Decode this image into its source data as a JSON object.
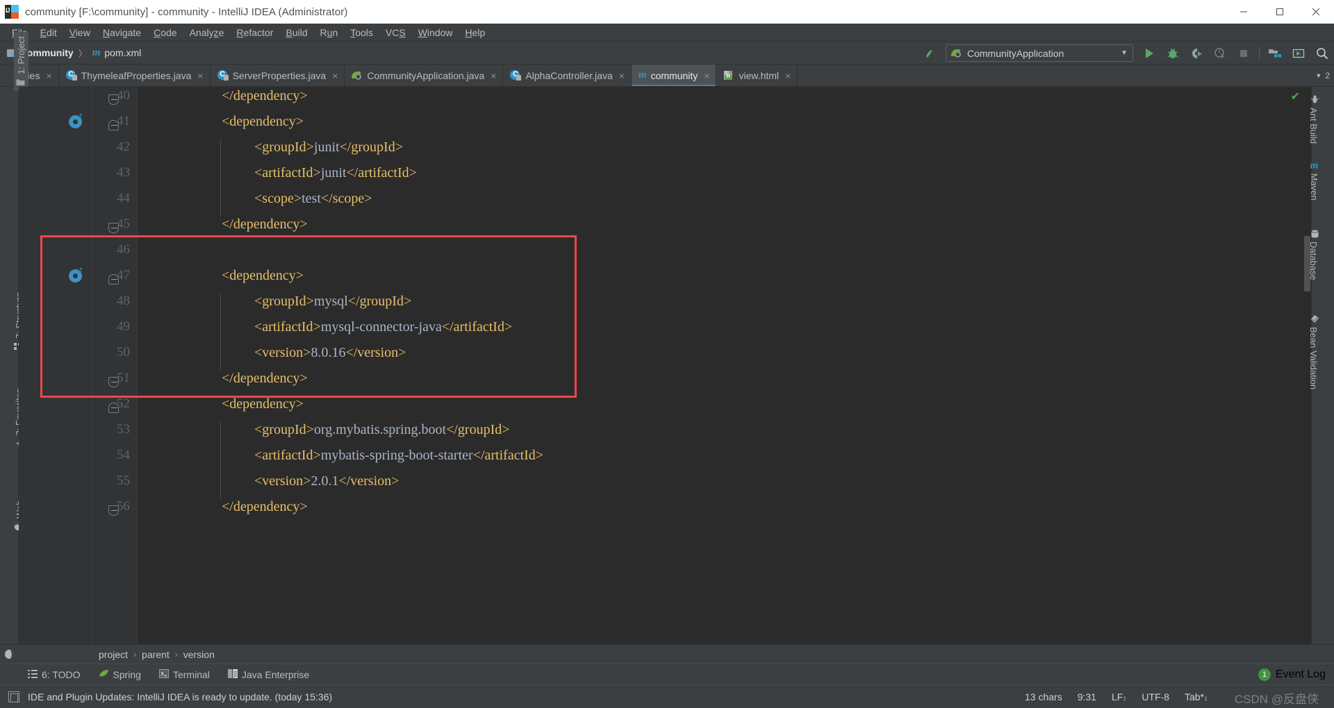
{
  "window": {
    "title": "community [F:\\community] - community - IntelliJ IDEA (Administrator)",
    "minimize_label": "—",
    "maximize_label": "❐",
    "close_label": "✕"
  },
  "menubar": {
    "items": [
      "File",
      "Edit",
      "View",
      "Navigate",
      "Code",
      "Analyze",
      "Refactor",
      "Build",
      "Run",
      "Tools",
      "VCS",
      "Window",
      "Help"
    ]
  },
  "navbar": {
    "crumbs": [
      "community",
      "pom.xml"
    ],
    "separator": "〉",
    "run_config": {
      "name": "CommunityApplication",
      "caret": "▼"
    },
    "buttons": [
      {
        "name": "build-hammer-icon",
        "title": "Build"
      },
      {
        "name": "run-icon",
        "title": "Run"
      },
      {
        "name": "debug-icon",
        "title": "Debug"
      },
      {
        "name": "run-with-coverage-icon",
        "title": "Run with Coverage"
      },
      {
        "name": "profiler-icon",
        "title": "Profiler"
      },
      {
        "name": "stop-icon",
        "title": "Stop"
      },
      {
        "name": "project-structure-icon",
        "title": "Project Structure"
      },
      {
        "name": "update-project-icon",
        "title": "Update Project"
      },
      {
        "name": "search-icon",
        "title": "Search Everywhere"
      }
    ]
  },
  "tabs": {
    "items": [
      {
        "label": "rties",
        "icon": "class-icon",
        "active": false,
        "truncated": true
      },
      {
        "label": "ThymeleafProperties.java",
        "icon": "class-icon",
        "active": false
      },
      {
        "label": "ServerProperties.java",
        "icon": "class-icon",
        "active": false
      },
      {
        "label": "CommunityApplication.java",
        "icon": "spring-boot-icon",
        "active": false
      },
      {
        "label": "AlphaController.java",
        "icon": "class-icon",
        "active": false
      },
      {
        "label": "community",
        "icon": "maven-icon",
        "active": true
      },
      {
        "label": "view.html",
        "icon": "html-icon",
        "active": false
      }
    ],
    "close_glyph": "×",
    "overflow_count": "2"
  },
  "left_tool_strip": {
    "items": [
      {
        "label": "1: Project",
        "icon": "folder-icon",
        "selected": true
      },
      {
        "label": "7: Structure",
        "icon": "structure-icon",
        "selected": false
      },
      {
        "label": "2: Favorites",
        "icon": "star-icon",
        "selected": false
      },
      {
        "label": "Web",
        "icon": "web-icon",
        "selected": false
      }
    ]
  },
  "right_tool_strip": {
    "items": [
      {
        "label": "Ant Build",
        "icon": "ant-icon"
      },
      {
        "label": "Maven",
        "icon": "maven-icon"
      },
      {
        "label": "Database",
        "icon": "database-icon"
      },
      {
        "label": "Bean Validation",
        "icon": "bean-validation-icon"
      }
    ]
  },
  "editor": {
    "language": "xml",
    "first_line_number": 40,
    "lines": [
      {
        "num": 40,
        "indent": 1,
        "segments": [
          {
            "t": "tag",
            "v": "</dependency>"
          }
        ],
        "fold": "end"
      },
      {
        "num": 41,
        "indent": 1,
        "segments": [
          {
            "t": "tag",
            "v": "<dependency>"
          }
        ],
        "fold": "start",
        "maven_marker": true
      },
      {
        "num": 42,
        "indent": 2,
        "segments": [
          {
            "t": "tag",
            "v": "<groupId>"
          },
          {
            "t": "txt",
            "v": "junit"
          },
          {
            "t": "tag",
            "v": "</groupId>"
          }
        ]
      },
      {
        "num": 43,
        "indent": 2,
        "segments": [
          {
            "t": "tag",
            "v": "<artifactId>"
          },
          {
            "t": "txt",
            "v": "junit"
          },
          {
            "t": "tag",
            "v": "</artifactId>"
          }
        ]
      },
      {
        "num": 44,
        "indent": 2,
        "segments": [
          {
            "t": "tag",
            "v": "<scope>"
          },
          {
            "t": "txt",
            "v": "test"
          },
          {
            "t": "tag",
            "v": "</scope>"
          }
        ]
      },
      {
        "num": 45,
        "indent": 1,
        "segments": [
          {
            "t": "tag",
            "v": "</dependency>"
          }
        ],
        "fold": "end"
      },
      {
        "num": 46,
        "indent": 1,
        "segments": []
      },
      {
        "num": 47,
        "indent": 1,
        "segments": [
          {
            "t": "tag",
            "v": "<dependency>"
          }
        ],
        "fold": "start",
        "maven_marker": true
      },
      {
        "num": 48,
        "indent": 2,
        "segments": [
          {
            "t": "tag",
            "v": "<groupId>"
          },
          {
            "t": "txt",
            "v": "mysql"
          },
          {
            "t": "tag",
            "v": "</groupId>"
          }
        ]
      },
      {
        "num": 49,
        "indent": 2,
        "segments": [
          {
            "t": "tag",
            "v": "<artifactId>"
          },
          {
            "t": "txt",
            "v": "mysql-connector-java"
          },
          {
            "t": "tag",
            "v": "</artifactId>"
          }
        ]
      },
      {
        "num": 50,
        "indent": 2,
        "segments": [
          {
            "t": "tag",
            "v": "<version>"
          },
          {
            "t": "txt",
            "v": "8.0.16"
          },
          {
            "t": "tag",
            "v": "</version>"
          }
        ]
      },
      {
        "num": 51,
        "indent": 1,
        "segments": [
          {
            "t": "tag",
            "v": "</dependency>"
          }
        ],
        "fold": "end"
      },
      {
        "num": 52,
        "indent": 1,
        "segments": [
          {
            "t": "tag",
            "v": "<dependency>"
          }
        ],
        "fold": "start"
      },
      {
        "num": 53,
        "indent": 2,
        "segments": [
          {
            "t": "tag",
            "v": "<groupId>"
          },
          {
            "t": "txt",
            "v": "org.mybatis.spring.boot"
          },
          {
            "t": "tag",
            "v": "</groupId>"
          }
        ]
      },
      {
        "num": 54,
        "indent": 2,
        "segments": [
          {
            "t": "tag",
            "v": "<artifactId>"
          },
          {
            "t": "txt",
            "v": "mybatis-spring-boot-starter"
          },
          {
            "t": "tag",
            "v": "</artifactId>"
          }
        ]
      },
      {
        "num": 55,
        "indent": 2,
        "segments": [
          {
            "t": "tag",
            "v": "<version>"
          },
          {
            "t": "txt",
            "v": "2.0.1"
          },
          {
            "t": "tag",
            "v": "</version>"
          }
        ]
      },
      {
        "num": 56,
        "indent": 1,
        "segments": [
          {
            "t": "tag",
            "v": "</dependency>"
          }
        ],
        "fold": "end"
      }
    ],
    "highlight_box": {
      "color": "#f4464a",
      "from_line": 46,
      "to_line": 51
    },
    "inspection_ok_glyph": "✔"
  },
  "breadcrumb": {
    "items": [
      "project",
      "parent",
      "version"
    ],
    "separator": "›"
  },
  "tool_windows": {
    "items": [
      {
        "label": "6: TODO",
        "icon": "todo-icon"
      },
      {
        "label": "Spring",
        "icon": "spring-icon"
      },
      {
        "label": "Terminal",
        "icon": "terminal-icon"
      },
      {
        "label": "Java Enterprise",
        "icon": "java-enterprise-icon"
      }
    ],
    "event_log": {
      "label": "Event Log",
      "count": "1"
    }
  },
  "statusbar": {
    "message": "IDE and Plugin Updates: IntelliJ IDEA is ready to update. (today 15:36)",
    "chars": "13 chars",
    "caret": "9:31",
    "line_separator": "LF",
    "line_separator_caret": "↕",
    "encoding": "UTF-8",
    "indent": "Tab*",
    "indent_caret": "↕"
  },
  "watermark": "CSDN @反盘侠",
  "colors": {
    "accent": "#3592c4",
    "highlight": "#f4464a",
    "tag": "#e8bf6a",
    "text": "#a9b7c6",
    "editor_bg": "#2b2b2b",
    "chrome_bg": "#3c3f41",
    "gutter_bg": "#313335"
  }
}
